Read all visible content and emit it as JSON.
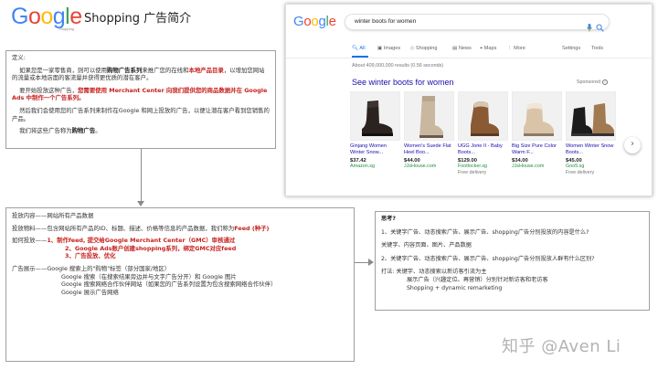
{
  "header": {
    "logo_text": "Google",
    "logo_sub": "Shopping",
    "title": "Shopping 广告简介"
  },
  "definition": {
    "label": "定义:",
    "p1_pre": "如果您是一家零售商，则可以使用",
    "p1_b1": "购物广告系列",
    "p1_mid": "来推广您的在线和",
    "p1_b2": "本地产品目录",
    "p1_post": "，以增加您网站的流量或本地店面的客流量并获得更优质的潜在客户。",
    "p2_pre": "要开始投放这种广告，",
    "p2_red": "您需要使用 Merchant Center 向我们提供您的商品数据并在 Google Ads 中制作一个广告系列。",
    "p3": "然后我们会使用您的广告系列来制作在Google 和网上投放的广告，以便让潜在客户看到您销售的产品。",
    "p4_pre": "我们将这些广告称为",
    "p4_b": "购物广告",
    "p4_post": "。"
  },
  "content": {
    "line1": "投放内容——网站所有产品数据",
    "line2_pre": "投放物料——包含网站所有产品的ID、标题、描述、价格等信息的产品数据，我们称为",
    "line2_red": "Feed (种子)",
    "how_label": "如何投放——",
    "step1": "1、制作feed, 提交给Google Merchant Center（GMC）审核通过",
    "step2": "2、Google Ads账户创建shopping系列，绑定GMC对应feed",
    "step3": "3、广告投放、优化",
    "display_label": "广告展示——Google 搜索上的\"购物\"标签（部分国家/地区）",
    "disp1": "Google 搜索（在搜索结果旁边并与文字广告分开）和 Google 图片",
    "disp2": "Google 搜索网络合作伙伴网站（如果您的广告系列设置为包含搜索网络合作伙伴）",
    "disp3": "Google 展示广告网络"
  },
  "think": {
    "title": "思考?",
    "q1": "1、关键字广告、动态搜索广告、展示广告、shopping广告分别投放的内容是什么?",
    "a1": "关键字、内容页面、图片、产品数据",
    "q2": "2、关键字广告、动态搜索广告、展示广告、shopping广告分别投放人群有什么区别?",
    "a2_1": "打法: 关键字、动态搜索以新访客引流为主",
    "a2_2": "展示广告（兴趣定位、再营销）分别针对新访客和老访客",
    "a2_3": "Shopping + dynamic remarketing"
  },
  "search_shot": {
    "logo": "Google",
    "query": "winter boots for women",
    "tabs": [
      {
        "label": "All",
        "icon": "search-icon"
      },
      {
        "label": "Images",
        "icon": "image-icon"
      },
      {
        "label": "Shopping",
        "icon": "tag-icon"
      },
      {
        "label": "News",
        "icon": "news-icon"
      },
      {
        "label": "Maps",
        "icon": "map-pin-icon"
      },
      {
        "label": "More",
        "icon": "more-icon"
      },
      {
        "label": "Settings",
        "icon": ""
      },
      {
        "label": "Tools",
        "icon": ""
      }
    ],
    "results_count": "About 409,000,000 results (0.56 seconds)",
    "ads_title": "See winter boots for women",
    "sponsored": "Sponsored",
    "products": [
      {
        "name": "Ginjang Women Winter Snow...",
        "price": "$37.42",
        "store": "Amazon.sg",
        "shipping": ""
      },
      {
        "name": "Women's Suede Flat Heel Boo...",
        "price": "$44.00",
        "store": "JJsHouse.com",
        "shipping": ""
      },
      {
        "name": "UGG Jorie II - Baby Boots...",
        "price": "$129.00",
        "store": "Footlocker.sg",
        "shipping": "Free delivery"
      },
      {
        "name": "Big Size Pure Color Warm F...",
        "price": "$34.00",
        "store": "JJsHouse.com",
        "shipping": ""
      },
      {
        "name": "Women Winter Snow Boots...",
        "price": "$45.00",
        "store": "Goo5.sg",
        "shipping": "Free delivery"
      }
    ]
  },
  "watermark": "知乎 @Aven Li",
  "colors": {
    "google_blue": "#4285f4",
    "google_red": "#ea4335",
    "google_yellow": "#fbbc05",
    "google_green": "#34a853",
    "emphasis_red": "#c5221f",
    "link_blue": "#1a0dab"
  }
}
